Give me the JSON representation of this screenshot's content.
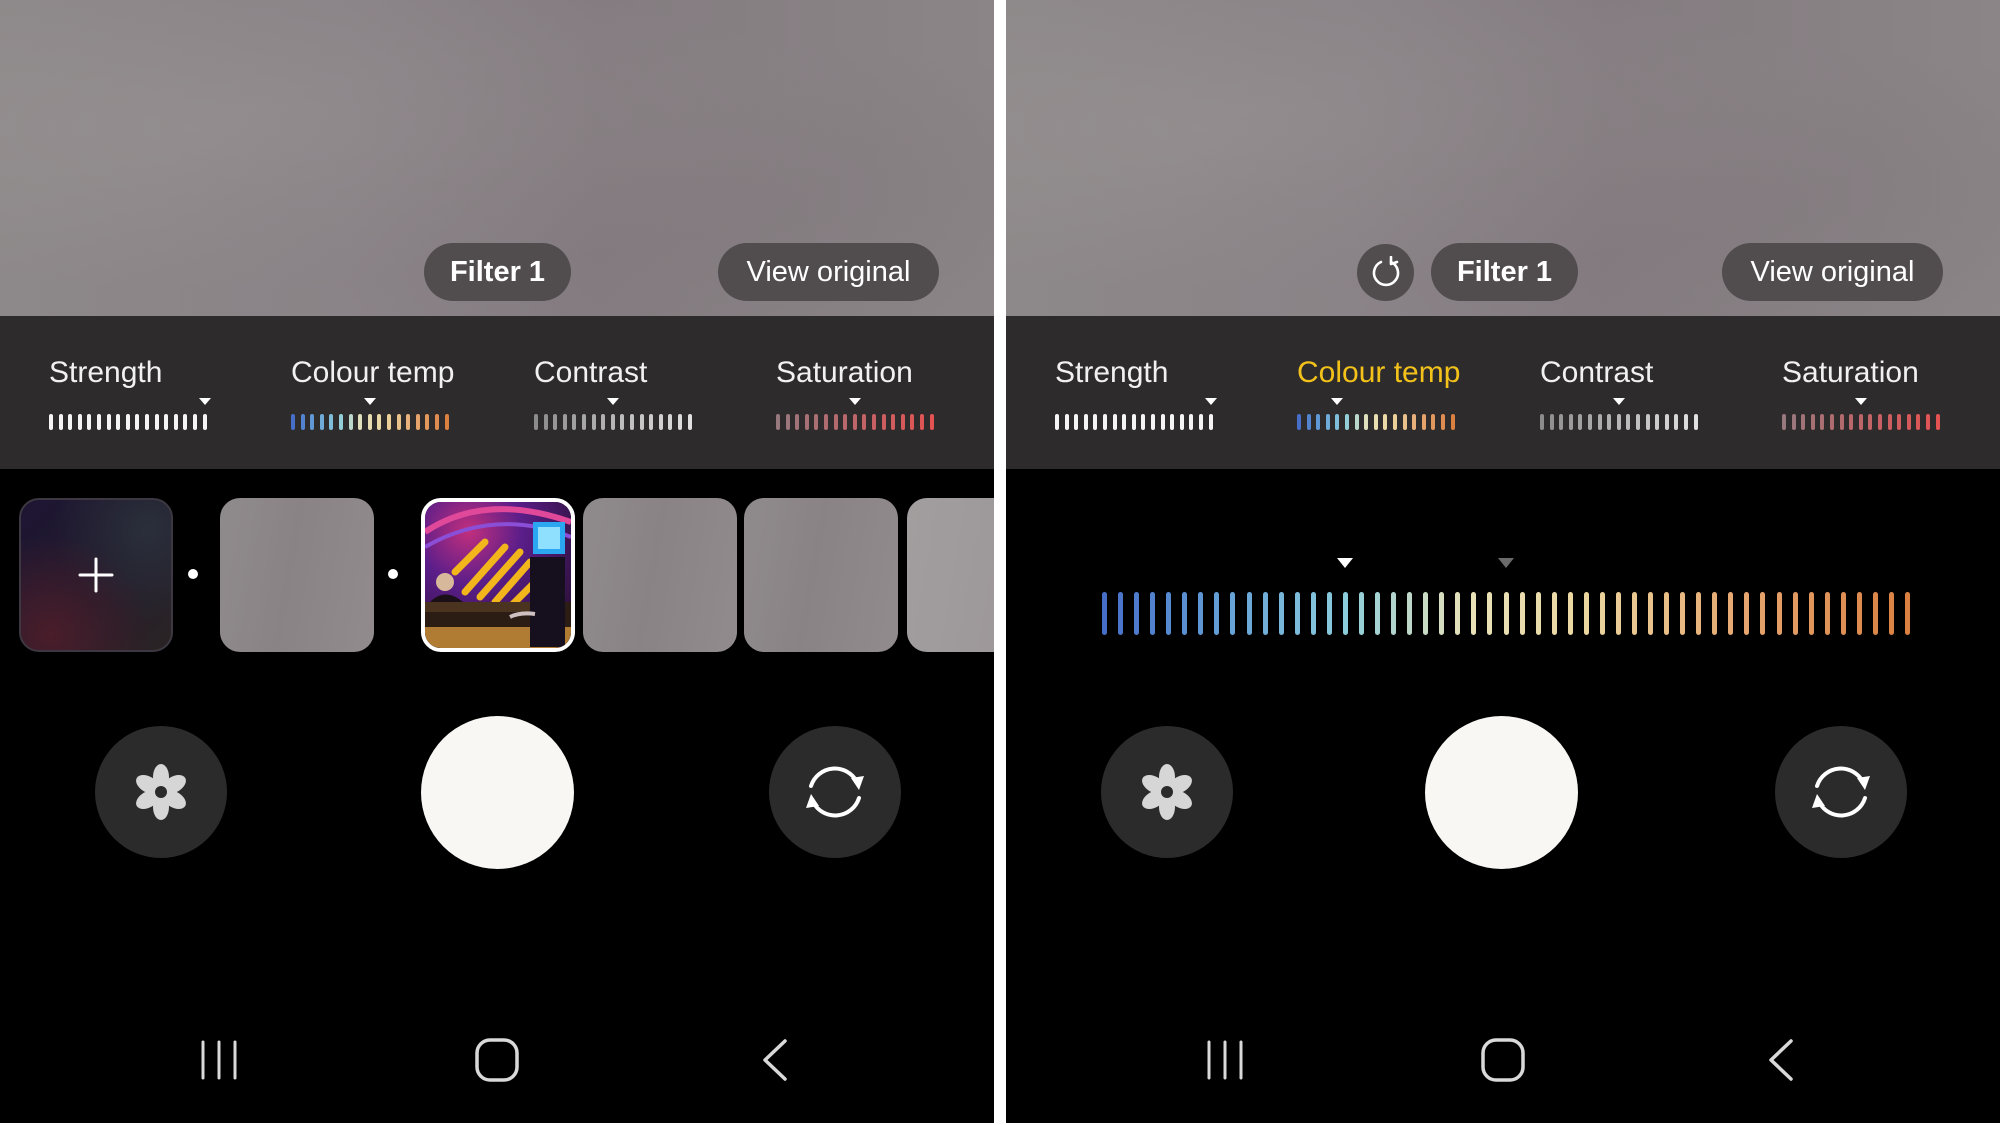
{
  "screens": [
    {
      "id": "left",
      "preview": {
        "filter_label": "Filter 1",
        "view_original_label": "View original",
        "show_reset": false
      },
      "adjustments": [
        {
          "label": "Strength",
          "active": false,
          "value_index": 16,
          "tick_count": 17,
          "palette": "white"
        },
        {
          "label": "Colour temp",
          "active": false,
          "value_index": 8,
          "tick_count": 17,
          "palette": "temp"
        },
        {
          "label": "Contrast",
          "active": false,
          "value_index": 8,
          "tick_count": 17,
          "palette": "contrast"
        },
        {
          "label": "Saturation",
          "active": false,
          "value_index": 8,
          "tick_count": 17,
          "palette": "saturation"
        }
      ],
      "filter_strip": {
        "add_label": "+",
        "tiles": [
          {
            "type": "add",
            "name": "add-filter"
          },
          {
            "type": "separator"
          },
          {
            "type": "gray",
            "name": "original"
          },
          {
            "type": "separator"
          },
          {
            "type": "art",
            "name": "filter-1",
            "selected": true
          },
          {
            "type": "gray",
            "name": "filter"
          },
          {
            "type": "gray",
            "name": "filter"
          },
          {
            "type": "gray",
            "name": "filter"
          }
        ]
      }
    },
    {
      "id": "right",
      "preview": {
        "filter_label": "Filter 1",
        "view_original_label": "View original",
        "show_reset": true,
        "reset_icon": "reset-icon"
      },
      "adjustments": [
        {
          "label": "Strength",
          "active": false,
          "value_index": 16,
          "tick_count": 17,
          "palette": "white"
        },
        {
          "label": "Colour temp",
          "active": true,
          "value_index": 4,
          "tick_count": 17,
          "palette": "temp"
        },
        {
          "label": "Contrast",
          "active": false,
          "value_index": 8,
          "tick_count": 17,
          "palette": "contrast"
        },
        {
          "label": "Saturation",
          "active": false,
          "value_index": 8,
          "tick_count": 17,
          "palette": "saturation"
        }
      ],
      "colour_temp_slider": {
        "tick_count": 51,
        "value_index": 15,
        "default_index": 25
      }
    }
  ],
  "controls": {
    "effects_icon": "flower-effects-icon",
    "shutter": "shutter-button",
    "flip_icon": "switch-camera-icon"
  },
  "navbar": {
    "recents_icon": "recents-icon",
    "home_icon": "home-icon",
    "back_icon": "back-icon"
  },
  "colors": {
    "accent": "#f2c21b",
    "adjust_panel": "#2e2b2c",
    "pill": "#514c4e",
    "shutter": "#f8f7f3"
  }
}
